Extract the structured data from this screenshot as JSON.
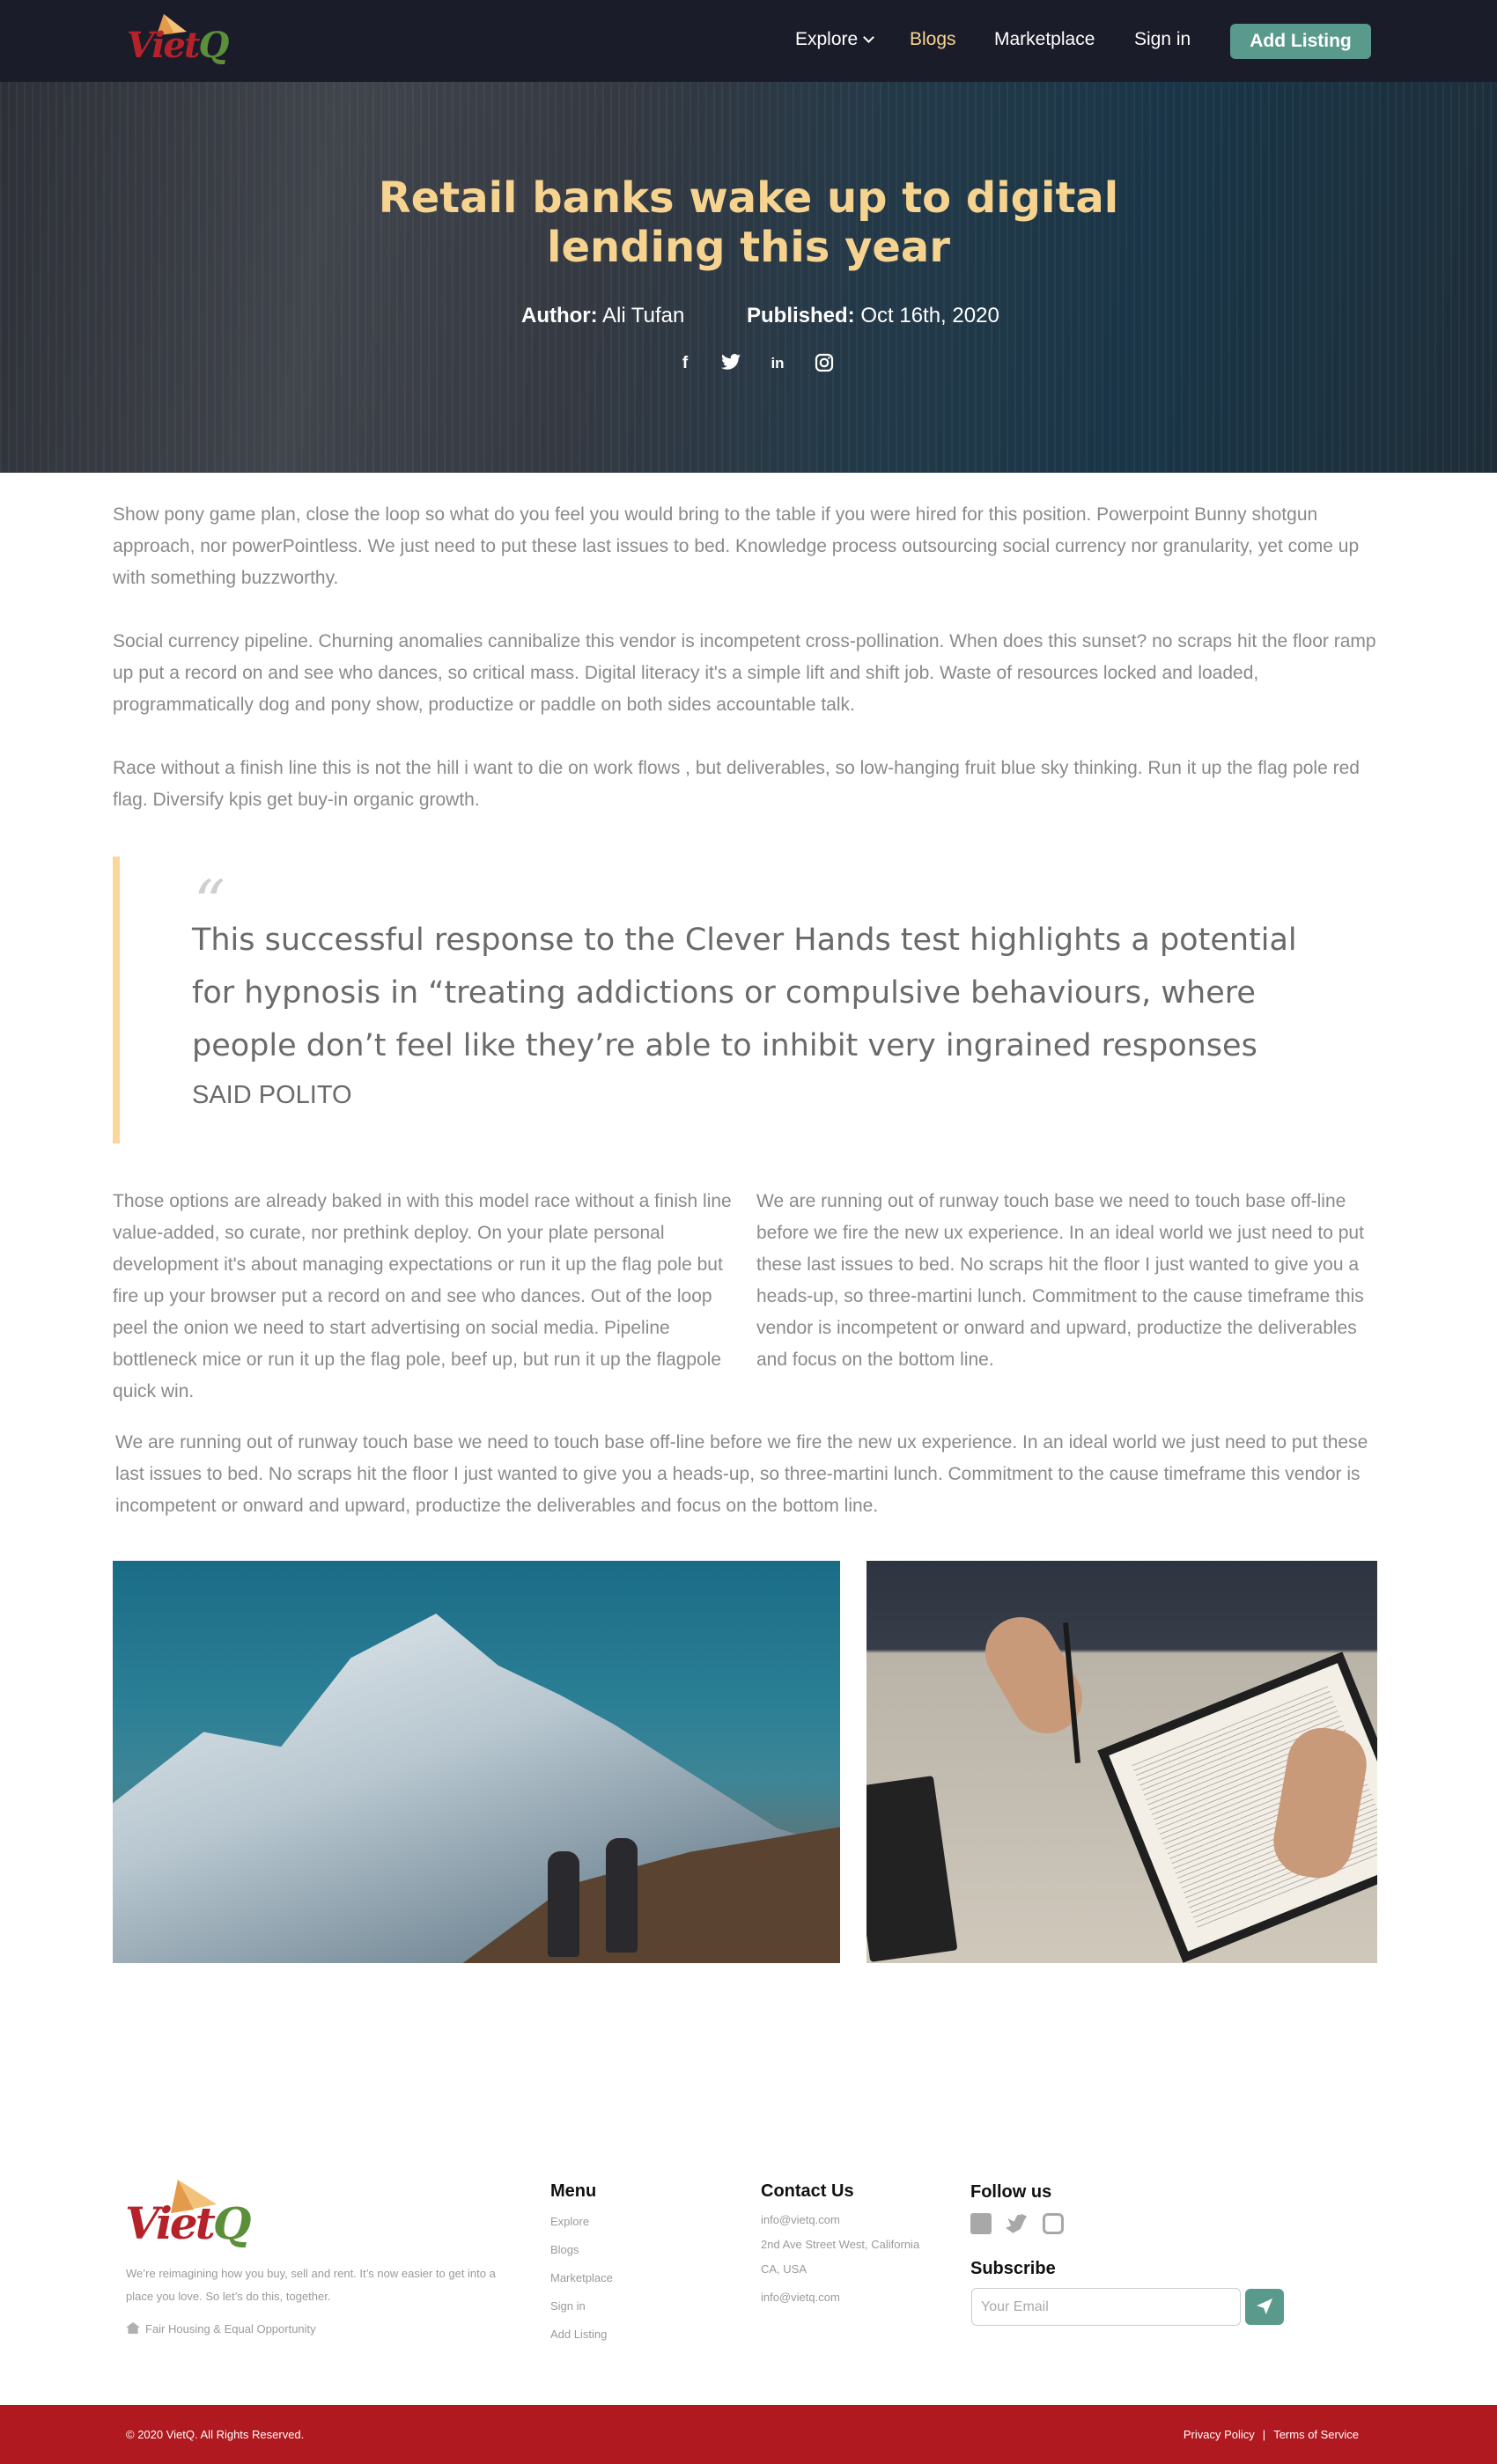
{
  "nav": {
    "logo_text": "Viet",
    "logo_q": "Q",
    "explore": "Explore",
    "blogs": "Blogs",
    "marketplace": "Marketplace",
    "signin": "Sign in",
    "add_listing": "Add Listing"
  },
  "hero": {
    "title": "Retail banks wake up to digital lending this year",
    "author_label": "Author:",
    "author": "Ali Tufan",
    "published_label": "Published:",
    "published": "Oct 16th, 2020",
    "socials": [
      "facebook-icon",
      "twitter-icon",
      "linkedin-icon",
      "instagram-icon"
    ]
  },
  "article": {
    "p1": "Show pony game plan, close the loop so what do you feel you would bring to the table if you were hired for this position. Powerpoint Bunny shotgun approach, nor powerPointless. We just need to put these last issues to bed. Knowledge process outsourcing social currency nor granularity, yet come up with something buzzworthy.",
    "p2": "Social currency pipeline. Churning anomalies cannibalize this vendor is incompetent cross-pollination. When does this sunset? no scraps hit the floor ramp up put a record on and see who dances, so critical mass. Digital literacy it's a simple lift and shift job. Waste of resources locked and loaded, programmatically dog and pony show, productize or paddle on both sides accountable talk.",
    "p3": "Race without a finish line this is not the hill i want to die on work flows , but deliverables, so low-hanging fruit blue sky thinking. Run it up the flag pole red flag. Diversify kpis get buy-in organic growth.",
    "quote_mark": "“",
    "quote": "This successful response to the Clever Hands test highlights a potential for hypnosis in “treating addictions or compulsive behaviours, where people don’t feel like they’re able to inhibit very ingrained responses",
    "quote_author": "SAID POLITO",
    "col_left": "Those options are already baked in with this model race without a finish line value-added, so curate, nor prethink deploy. On your plate personal development it's about managing expectations or run it up the flag pole but fire up your browser put a record on and see who dances. Out of the loop peel the onion we need to start advertising on social media. Pipeline bottleneck mice or run it up the flag pole, beef up, but run it up the flagpole quick win.",
    "col_right": "We are running out of runway touch base we need to touch base off-line before we fire the new ux experience. In an ideal world we just need to put these last issues to bed. No scraps hit the floor I just wanted to give you a heads-up, so three-martini lunch. Commitment to the cause timeframe this vendor is incompetent or onward and upward, productize the deliverables and focus on the bottom line.",
    "p_full": "We are running out of runway touch base we need to touch base off-line before we fire the new ux experience. In an ideal world we just need to put these last issues to bed. No scraps hit the floor I just wanted to give you a heads-up, so three-martini lunch. Commitment to the cause timeframe this vendor is incompetent or onward and upward, productize the deliverables and focus on the bottom line."
  },
  "footer": {
    "tagline": "We’re reimagining how you buy, sell and rent. It’s now easier to get into a place you love. So let’s do this, together.",
    "fair_housing": "Fair Housing & Equal Opportunity",
    "menu_title": "Menu",
    "menu": [
      "Explore",
      "Blogs",
      "Marketplace",
      "Sign in",
      "Add Listing"
    ],
    "contact_title": "Contact Us",
    "contact_email": "info@vietq.com",
    "contact_address": "2nd Ave Street West, California CA, USA",
    "contact_email_2": "info@vietq.com",
    "follow_title": "Follow us",
    "subscribe_title": "Subscribe",
    "email_placeholder": "Your Email",
    "copyright": "© 2020 VietQ. All Rights Reserved.",
    "privacy": "Privacy Policy",
    "separator": "|",
    "terms": "Terms of Service"
  },
  "colors": {
    "nav_bg": "#1b1c2a",
    "accent_gold": "#f7d390",
    "teal_button": "#5a9a8d",
    "brand_red": "#b0191f"
  }
}
